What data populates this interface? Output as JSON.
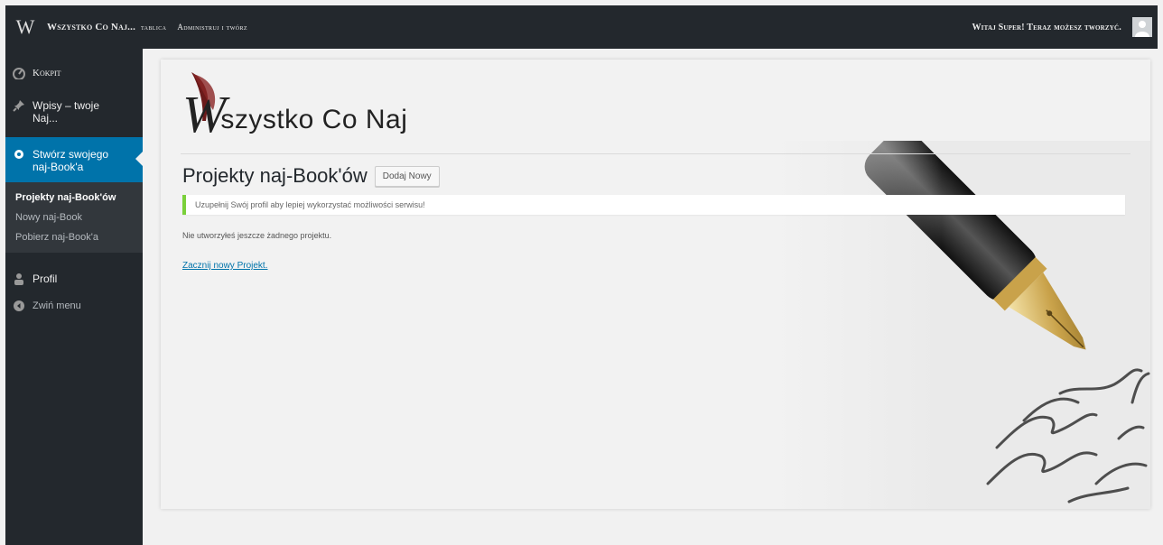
{
  "adminbar": {
    "site_name": "Wszystko Co Naj...",
    "dashboard_link": "tablica",
    "tagline": "Administruj i twórz",
    "greeting": "Witaj Super! Teraz możesz tworzyć."
  },
  "sidebar": {
    "items": [
      {
        "label": "Kokpit",
        "icon": "dashboard-icon"
      },
      {
        "label": "Wpisy – twoje Naj...",
        "icon": "pin-icon"
      },
      {
        "label": "Stwórz swojego naj-Book'a",
        "icon": "gear-icon",
        "active": true
      },
      {
        "label": "Profil",
        "icon": "user-icon"
      },
      {
        "label": "Zwiń menu",
        "icon": "collapse-icon"
      }
    ],
    "submenu": [
      {
        "label": "Projekty naj-Book'ów",
        "current": true
      },
      {
        "label": "Nowy naj-Book"
      },
      {
        "label": "Pobierz naj-Book'a"
      }
    ]
  },
  "main": {
    "logo_initial": "W",
    "logo_rest": "szystko Co Naj",
    "title": "Projekty naj-Book'ów",
    "add_new": "Dodaj Nowy",
    "notice": "Uzupełnij Swój profil aby lepiej wykorzystać możliwości serwisu!",
    "empty_message": "Nie utworzyłeś jeszcze żadnego projektu.",
    "start_link": "Zacznij nowy Projekt."
  },
  "colors": {
    "adminbar_bg": "#23282d",
    "active_menu": "#0073aa",
    "notice_border": "#7ad03a"
  }
}
